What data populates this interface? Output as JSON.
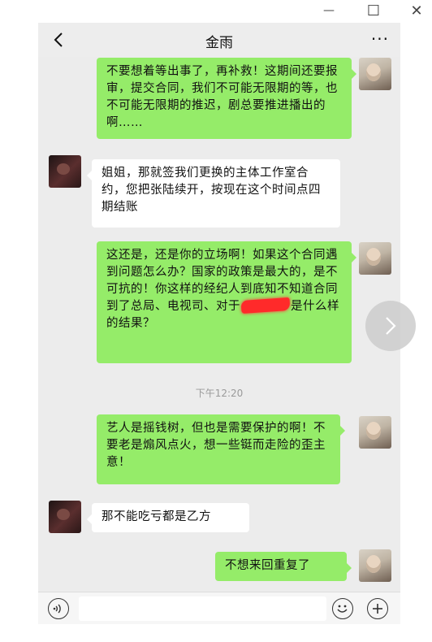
{
  "window": {
    "controls": {
      "minimize": "—",
      "maximize": "☐",
      "close": "✕"
    }
  },
  "chat": {
    "title": "金雨",
    "more": "···",
    "time_separator": "下午12:20",
    "messages": [
      {
        "sender": "me",
        "text": "不要想着等出事了，再补救！这期间还要报审，提交合同，我们不可能无限期的等，也不可能无限期的推迟，剧总要推进播出的啊……"
      },
      {
        "sender": "other",
        "text": "姐姐，那就签我们更换的主体工作室合约，您把张陆续开，按现在这个时间点四期结账"
      },
      {
        "sender": "me",
        "text_before": "这还是，还是你的立场啊！如果这个合同遇到问题怎么办？国家的政策是最大的，是不可抗的！你这样的经纪人到底知不知道合同到了总局、电视司、对于",
        "text_after": "是什么样的结果？"
      },
      {
        "sender": "me",
        "text": "艺人是摇钱树，但也是需要保护的啊！不要老是煽风点火，想一些铤而走险的歪主意！"
      },
      {
        "sender": "other",
        "text": "那不能吃亏都是乙方"
      },
      {
        "sender": "me",
        "text": "不想来回重复了"
      }
    ]
  },
  "icons": {
    "back": "back-chevron-icon",
    "voice": "voice-icon",
    "emoji": "emoji-icon",
    "plus": "plus-icon",
    "next": "chevron-right-icon"
  },
  "colors": {
    "my_bubble": "#95ec69",
    "their_bubble": "#ffffff",
    "chat_bg": "#ececec",
    "redaction": "#ff2a2a"
  }
}
